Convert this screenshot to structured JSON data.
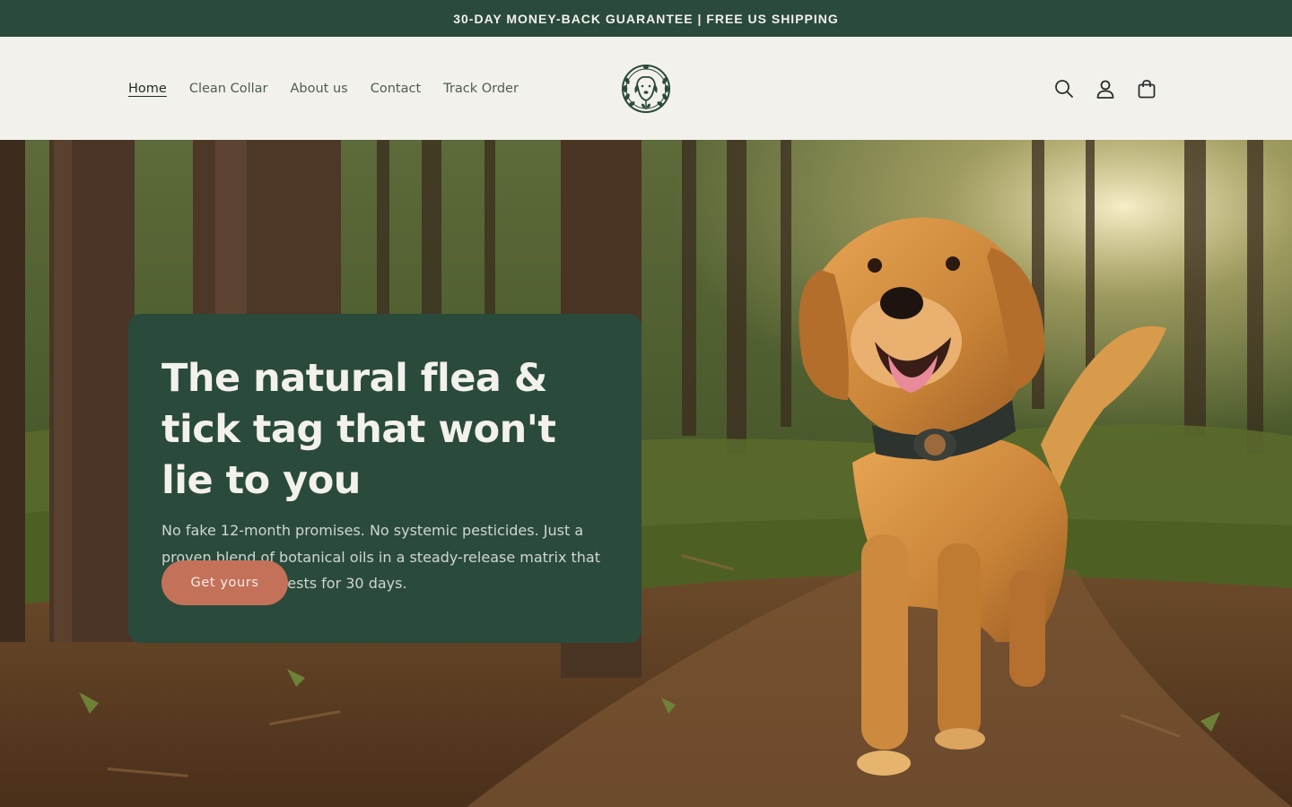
{
  "announcement": {
    "text": "30-DAY MONEY-BACK GUARANTEE | FREE US SHIPPING"
  },
  "nav": {
    "items": [
      {
        "label": "Home",
        "active": true
      },
      {
        "label": "Clean Collar",
        "active": false
      },
      {
        "label": "About us",
        "active": false
      },
      {
        "label": "Contact",
        "active": false
      },
      {
        "label": "Track Order",
        "active": false
      }
    ]
  },
  "header": {
    "logo_icon": "dog-wreath-logo",
    "icons": [
      "search-icon",
      "account-icon",
      "cart-icon"
    ]
  },
  "hero": {
    "title": "The natural flea & tick tag that won't lie to you",
    "text": "No fake 12-month promises. No systemic pesticides. Just a proven blend of botanical oils in a steady-release matrix that naturally repels pests for 30 days.",
    "button_label": "Get yours",
    "image": "golden-retriever-forest-photo"
  },
  "colors": {
    "brand_green": "#2a4a3c",
    "cream": "#f3f1ec",
    "accent_terracotta": "#c4715a"
  }
}
